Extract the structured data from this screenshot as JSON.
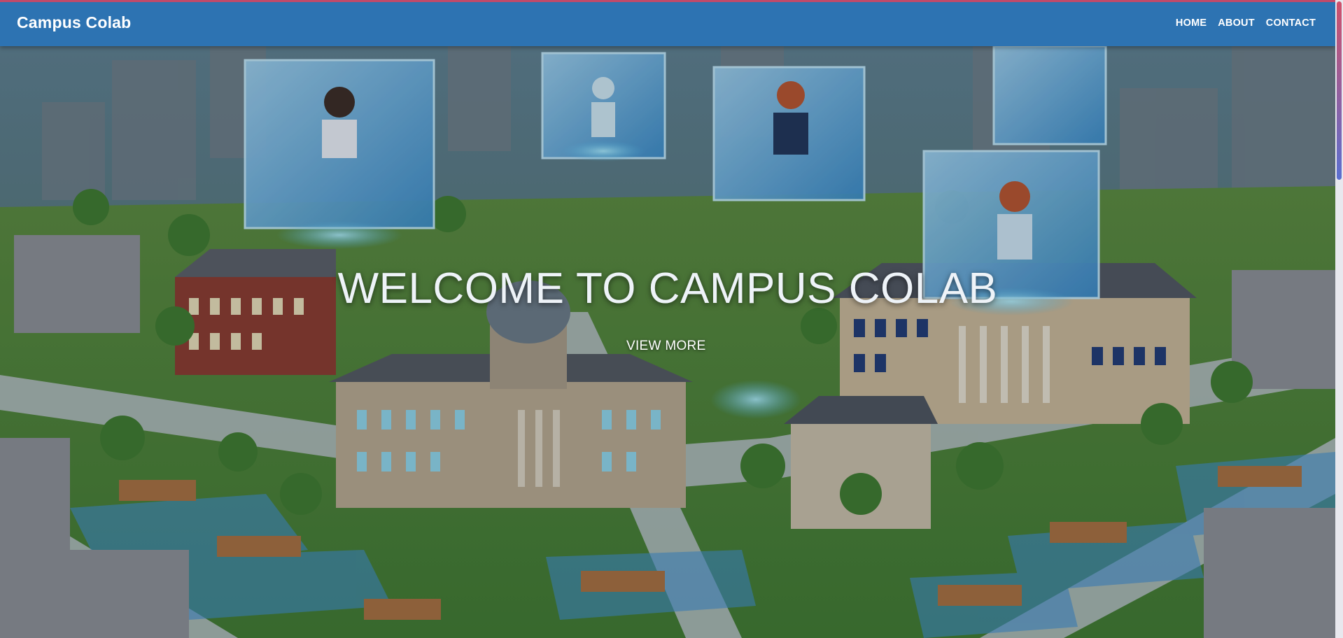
{
  "nav": {
    "brand": "Campus Colab",
    "links": [
      "HOME",
      "ABOUT",
      "CONTACT"
    ]
  },
  "hero": {
    "title": "WELCOME TO CAMPUS COLAB",
    "button_label": "VIEW MORE",
    "image": "campus-illustration"
  },
  "colors": {
    "navbar": "#2d73b2",
    "accent_strip": "#c14a6a",
    "text": "#ffffff"
  }
}
